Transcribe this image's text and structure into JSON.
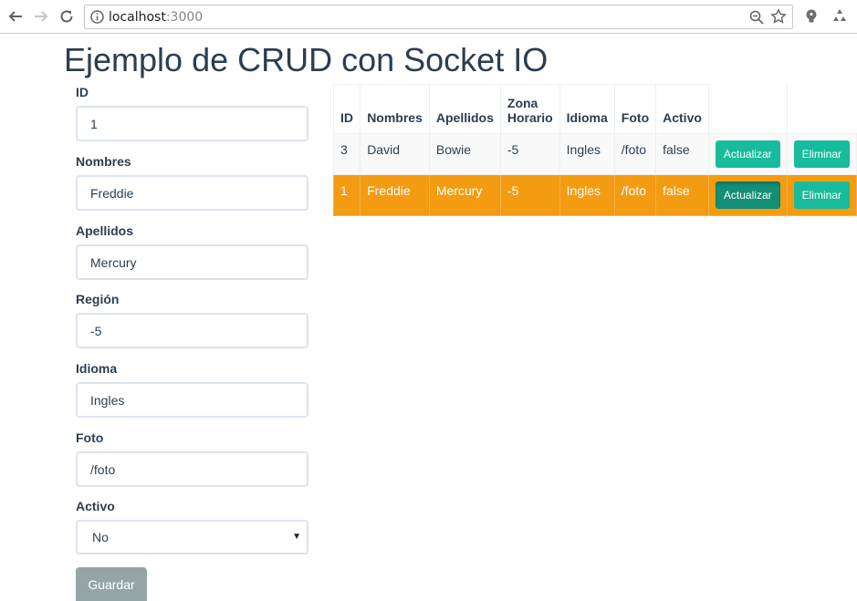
{
  "browser": {
    "url_host": "localhost",
    "url_port": ":3000"
  },
  "page": {
    "title": "Ejemplo de CRUD con Socket IO"
  },
  "form": {
    "fields": [
      {
        "label": "ID",
        "value": "1"
      },
      {
        "label": "Nombres",
        "value": "Freddie"
      },
      {
        "label": "Apellidos",
        "value": "Mercury"
      },
      {
        "label": "Región",
        "value": "-5"
      },
      {
        "label": "Idioma",
        "value": "Ingles"
      },
      {
        "label": "Foto",
        "value": "/foto"
      }
    ],
    "activo": {
      "label": "Activo",
      "selected": "No"
    },
    "submit_label": "Guardar"
  },
  "table": {
    "headers": [
      "ID",
      "Nombres",
      "Apellidos",
      "Zona Horario",
      "Idioma",
      "Foto",
      "Activo"
    ],
    "rows": [
      {
        "id": "3",
        "nombres": "David",
        "apellidos": "Bowie",
        "zona": "-5",
        "idioma": "Ingles",
        "foto": "/foto",
        "activo": "false",
        "selected": false
      },
      {
        "id": "1",
        "nombres": "Freddie",
        "apellidos": "Mercury",
        "zona": "-5",
        "idioma": "Ingles",
        "foto": "/foto",
        "activo": "false",
        "selected": true
      }
    ],
    "update_label": "Actualizar",
    "delete_label": "Eliminar"
  },
  "colors": {
    "primary": "#2c3e50",
    "success": "#18bc9c",
    "warning": "#f39c12",
    "muted": "#95a5a6"
  }
}
